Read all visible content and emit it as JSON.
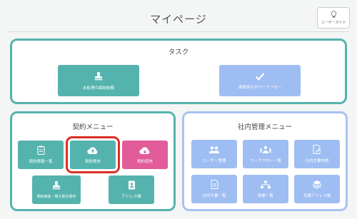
{
  "page": {
    "title": "マイページ"
  },
  "guide": {
    "label": "ユーザーガイド",
    "icon": "lightbulb-icon"
  },
  "task_panel": {
    "title": "タスク",
    "items": [
      {
        "label": "未処理の締結依頼",
        "icon": "stamp-icon",
        "color": "#55b3ad"
      },
      {
        "label": "承認待ちのワークフロー",
        "icon": "checkmark-icon",
        "color": "#9ebdf2"
      }
    ]
  },
  "contract_panel": {
    "title": "契約メニュー",
    "items": [
      {
        "label": "契約情報一覧",
        "icon": "clipboard-icon",
        "color": "#55b3ad"
      },
      {
        "label": "契約発信",
        "icon": "cloud-upload-icon",
        "color": "#55b3ad",
        "highlighted": true
      },
      {
        "label": "契約受信",
        "icon": "cloud-download-icon",
        "color": "#e15c99"
      },
      {
        "label": "契約締結・電子取引保存",
        "icon": "stamp-icon",
        "color": "#55b3ad"
      },
      {
        "label": "アドレス帳",
        "icon": "address-book-icon",
        "color": "#55b3ad"
      }
    ]
  },
  "internal_panel": {
    "title": "社内管理メニュー",
    "items": [
      {
        "label": "ユーザー管理",
        "icon": "users-icon",
        "color": "#9ebdf2"
      },
      {
        "label": "ワークフロー一覧",
        "icon": "workflow-icon",
        "color": "#9ebdf2"
      },
      {
        "label": "社内文書申請",
        "icon": "document-edit-icon",
        "color": "#9ebdf2"
      },
      {
        "label": "社内文書一覧",
        "icon": "document-list-icon",
        "color": "#9ebdf2"
      },
      {
        "label": "部署一覧",
        "icon": "departments-icon",
        "color": "#9ebdf2"
      },
      {
        "label": "共通アドレス帳",
        "icon": "layers-icon",
        "color": "#9ebdf2"
      }
    ]
  }
}
